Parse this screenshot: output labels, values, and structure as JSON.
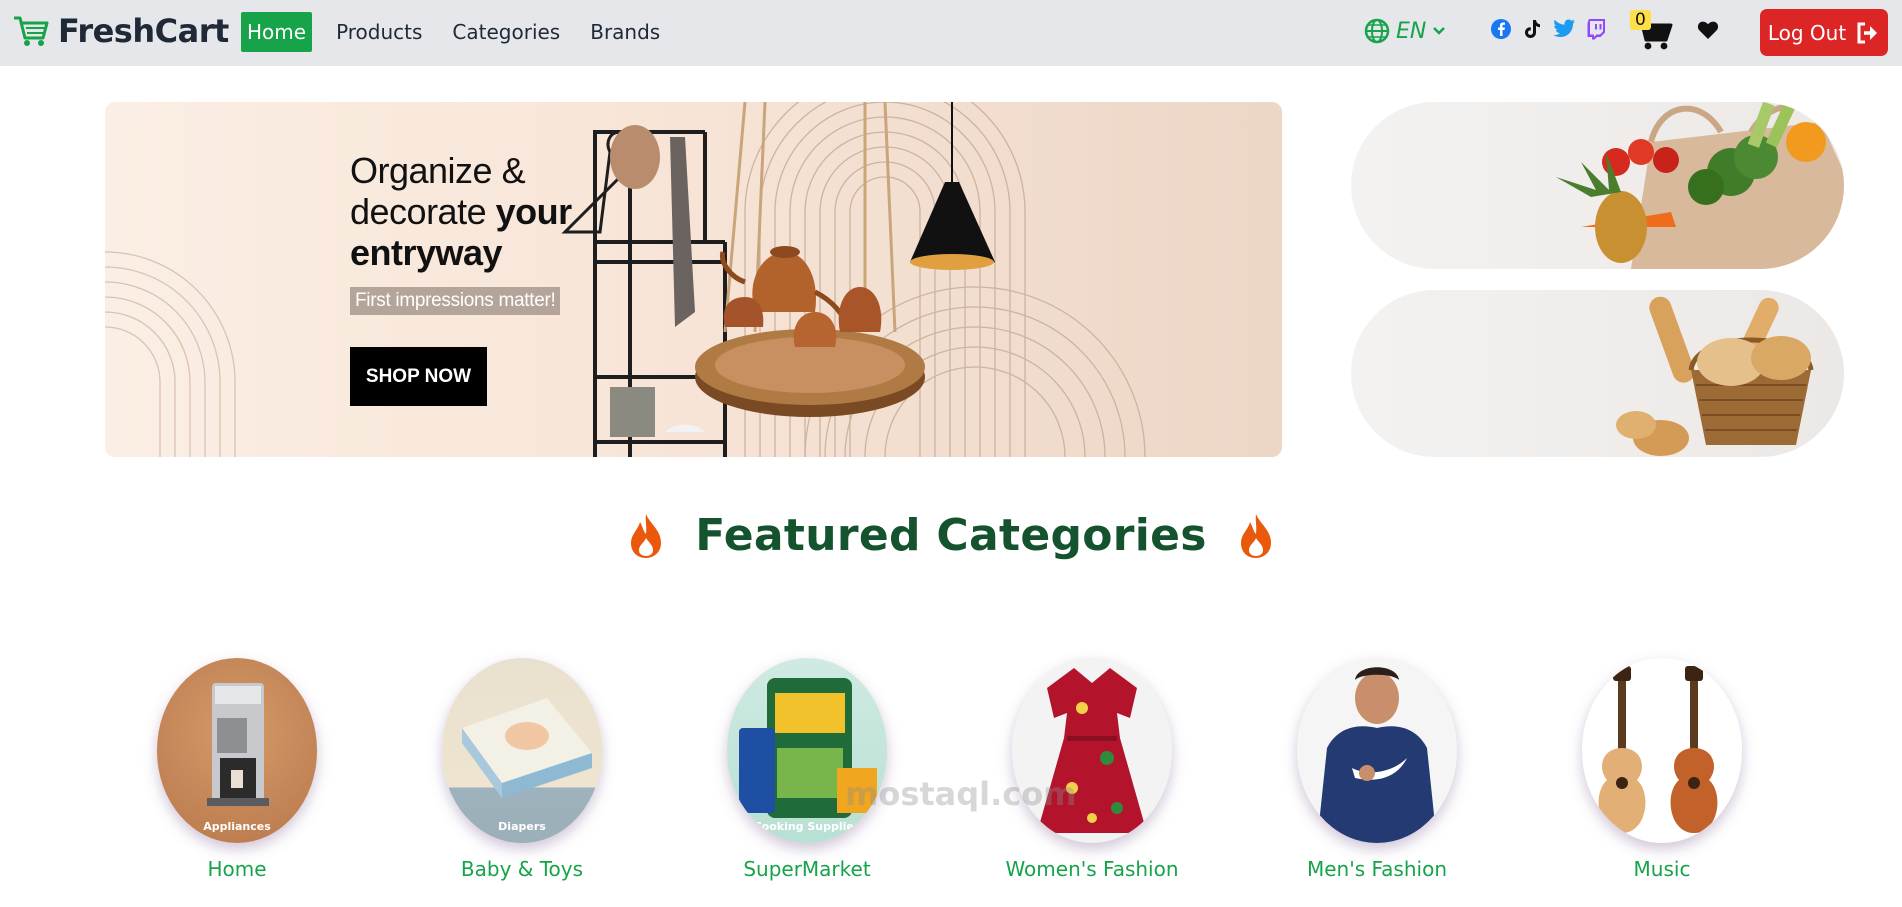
{
  "navbar": {
    "brand": "FreshCart",
    "links": [
      {
        "label": "Home",
        "active": true
      },
      {
        "label": "Products",
        "active": false
      },
      {
        "label": "Categories",
        "active": false
      },
      {
        "label": "Brands",
        "active": false
      }
    ],
    "language": "EN",
    "cart_count": "0",
    "logout_label": "Log Out",
    "colors": {
      "accent": "#16a34a",
      "logout": "#dc2626",
      "bar": "#e5e7eb"
    }
  },
  "hero": {
    "title_line1": "Organize &",
    "title_line2_plain": "decorate ",
    "title_line2_bold": "your",
    "title_line3": "entryway",
    "tagline": "First impressions matter!",
    "button": "SHOP NOW"
  },
  "featured": {
    "title": "Featured Categories",
    "categories": [
      {
        "name": "Home",
        "caption": "Appliances"
      },
      {
        "name": "Baby & Toys",
        "caption": "Diapers"
      },
      {
        "name": "SuperMarket",
        "caption": "Cooking Supplies"
      },
      {
        "name": "Women's Fashion",
        "caption": ""
      },
      {
        "name": "Men's Fashion",
        "caption": ""
      },
      {
        "name": "Music",
        "caption": ""
      }
    ]
  },
  "watermark": "mostaql.com"
}
